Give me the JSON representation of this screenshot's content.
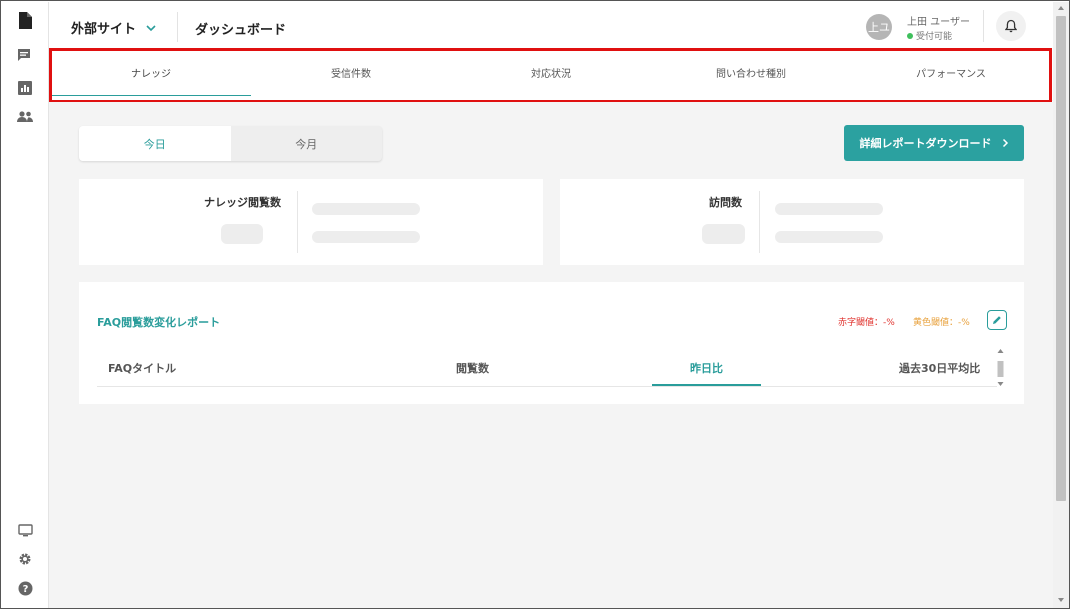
{
  "header": {
    "site_label": "外部サイト",
    "page_title": "ダッシュボード",
    "avatar_text": "上ユ",
    "user_name": "上田 ユーザー",
    "user_status": "受付可能"
  },
  "sidebar": {
    "icons": [
      "document-icon",
      "chat-icon",
      "chart-icon",
      "users-icon",
      "monitor-icon",
      "gear-icon",
      "help-icon"
    ]
  },
  "tabs": [
    {
      "label": "ナレッジ",
      "active": true
    },
    {
      "label": "受信件数",
      "active": false
    },
    {
      "label": "対応状況",
      "active": false
    },
    {
      "label": "問い合わせ種別",
      "active": false
    },
    {
      "label": "パフォーマンス",
      "active": false
    }
  ],
  "period": {
    "today": "今日",
    "month": "今月",
    "selected": "今日"
  },
  "download_button": "詳細レポートダウンロード",
  "stats": [
    {
      "label": "ナレッジ閲覧数"
    },
    {
      "label": "訪問数"
    }
  ],
  "report": {
    "title": "FAQ閲覧数変化レポート",
    "threshold_red": "赤字閾値：-%",
    "threshold_yellow": "黄色閾値：-%",
    "columns": [
      "FAQタイトル",
      "閲覧数",
      "昨日比",
      "過去30日平均比"
    ],
    "active_column": "昨日比"
  },
  "colors": {
    "accent": "#2ba1a0",
    "highlight": "#e01010",
    "red_threshold": "#e0342f",
    "yellow_threshold": "#e8a13c",
    "status_dot": "#3fbf5c"
  }
}
